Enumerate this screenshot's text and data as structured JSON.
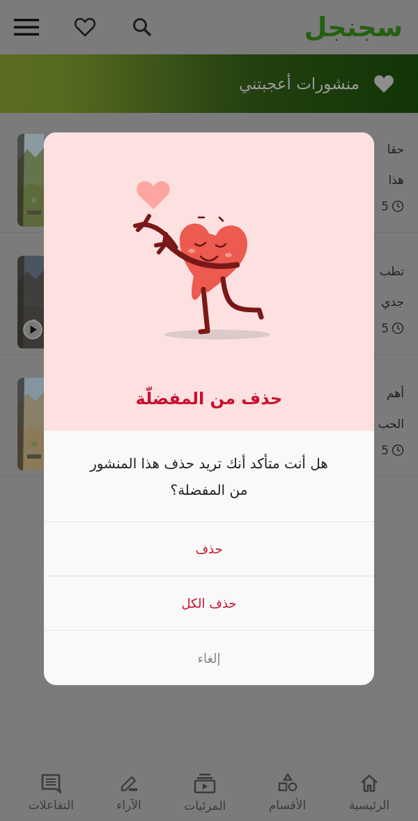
{
  "app_bar": {
    "logo": "سجنجل"
  },
  "banner": {
    "title": "منشورات أعجبتني"
  },
  "posts": [
    {
      "title_lines": [
        "حقا",
        "هذا"
      ],
      "meta": "5",
      "video": false
    },
    {
      "title_lines": [
        "تطب",
        "جدي"
      ],
      "meta": "5",
      "video": true
    },
    {
      "title_lines": [
        "أهم",
        "الحب"
      ],
      "meta": "5",
      "video": false
    }
  ],
  "dialog": {
    "title": "حذف من المفضلّة",
    "message": "هل أنت متأكد أنك تريد حذف هذا المنشور من المفضلة؟",
    "actions": [
      {
        "label": "حذف",
        "kind": "destructive"
      },
      {
        "label": "حذف الكل",
        "kind": "destructive"
      },
      {
        "label": "إلغاء",
        "kind": "cancel"
      }
    ]
  },
  "bottom_nav": [
    {
      "label": "الرئيسية"
    },
    {
      "label": "الأقسام"
    },
    {
      "label": "المرئيات"
    },
    {
      "label": "الآراء"
    },
    {
      "label": "التفاعلات"
    }
  ]
}
